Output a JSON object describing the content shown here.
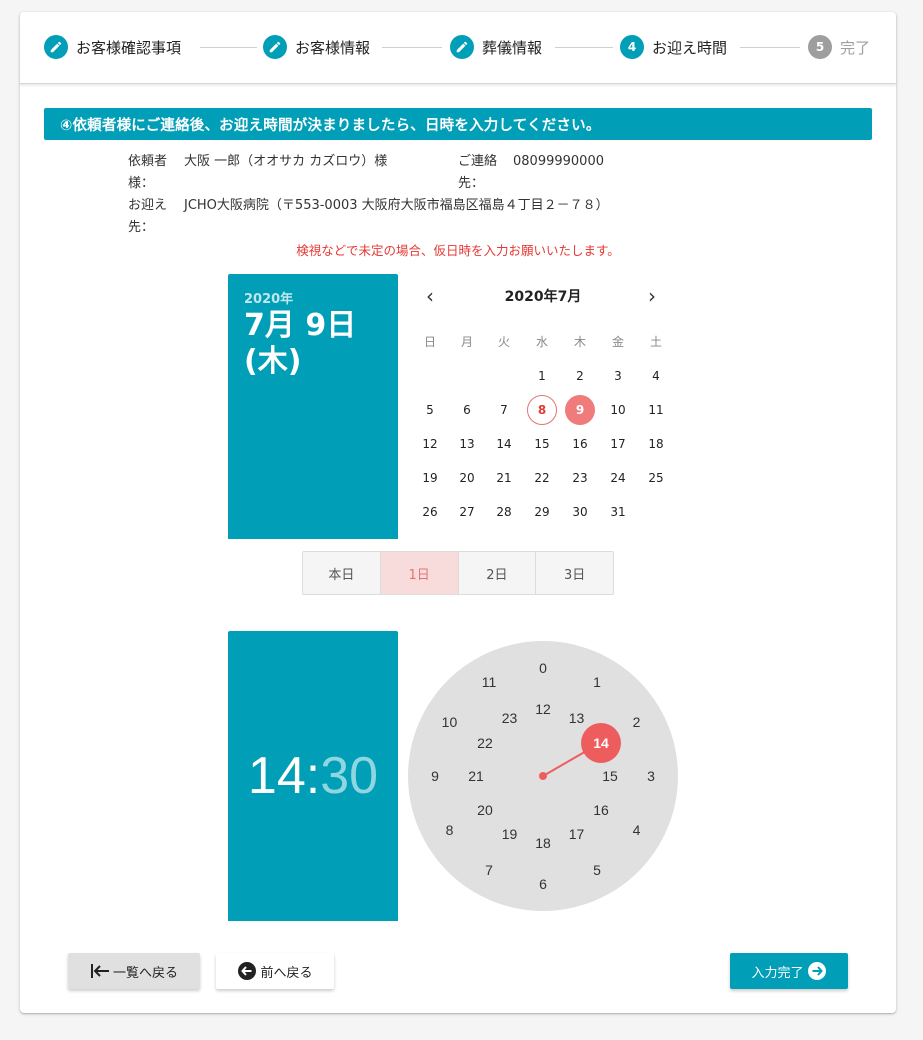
{
  "stepper": {
    "steps": [
      {
        "label": "お客様確認事項",
        "icon": "pencil-icon"
      },
      {
        "label": "お客様情報",
        "icon": "pencil-icon"
      },
      {
        "label": "葬儀情報",
        "icon": "pencil-icon"
      },
      {
        "label": "お迎え時間",
        "number": "4"
      },
      {
        "label": "完了",
        "number": "5"
      }
    ]
  },
  "banner": "④依頼者様にご連絡後、お迎え時間が決まりましたら、日時を入力してください。",
  "info": {
    "requester_label_1": "依頼者",
    "requester_label_2": "様：",
    "requester_value": "大阪 一郎（オオサカ カズロウ）様",
    "contact_label_1": "ご連絡",
    "contact_label_2": "先：",
    "contact_value": "08099990000",
    "pickup_label_1": "お迎え",
    "pickup_label_2": "先：",
    "pickup_value": "JCHO大阪病院（〒553-0003 大阪府大阪市福島区福島４丁目２－７８）"
  },
  "note": "検視などで未定の場合、仮日時を入力お願いいたします。",
  "date_panel": {
    "year": "2020年",
    "date_line": "7月 9日",
    "weekday_line": "(木)"
  },
  "calendar": {
    "title": "2020年7月",
    "prev_icon": "chevron-left-icon",
    "next_icon": "chevron-right-icon",
    "prev": "‹",
    "next": "›",
    "weekdays": [
      "日",
      "月",
      "火",
      "水",
      "木",
      "金",
      "土"
    ],
    "first_weekday_index": 3,
    "days_in_month": 31,
    "today": 8,
    "selected": 9
  },
  "quick": {
    "buttons": [
      "本日",
      "1日",
      "2日",
      "3日"
    ],
    "active_index": 1
  },
  "time": {
    "hour": "14",
    "sep": ":",
    "minute": "30",
    "outer_hours": [
      "0",
      "1",
      "2",
      "3",
      "4",
      "5",
      "6",
      "7",
      "8",
      "9",
      "10",
      "11"
    ],
    "inner_hours": [
      "12",
      "13",
      "14",
      "15",
      "16",
      "17",
      "18",
      "19",
      "20",
      "21",
      "22",
      "23"
    ],
    "selected_hour": "14"
  },
  "buttons": {
    "back_to_list": "一覧へ戻る",
    "back_to_list_icon": "arrow-to-left-icon",
    "prev": "前へ戻る",
    "prev_icon": "arrow-circle-left-icon",
    "done": "入力完了",
    "done_icon": "arrow-circle-right-icon"
  },
  "colors": {
    "accent": "#009fb7",
    "selected": "#ee5d5d",
    "today_ring": "#e57373",
    "note": "#e53935",
    "clock_face": "#e0e0e0"
  }
}
